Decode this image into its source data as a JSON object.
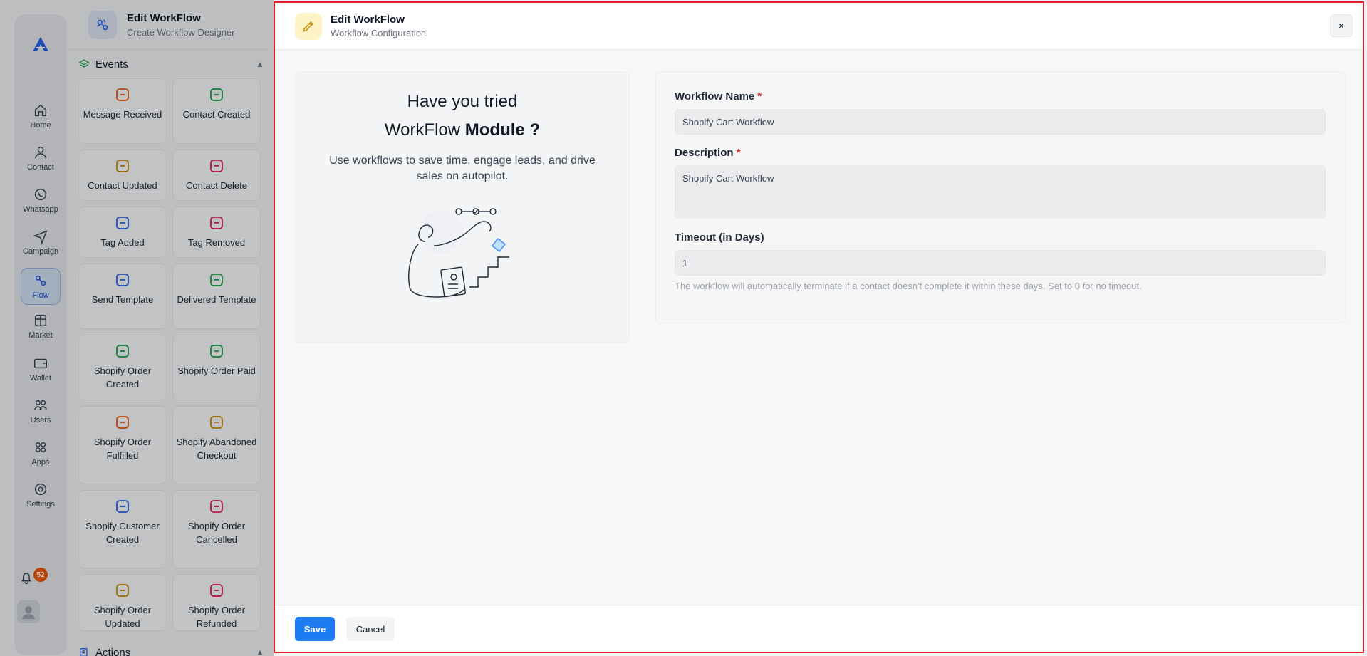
{
  "rail": {
    "items": [
      {
        "label": "Home",
        "icon": "home-icon"
      },
      {
        "label": "Contact",
        "icon": "user-icon"
      },
      {
        "label": "Whatsapp",
        "icon": "whatsapp-icon"
      },
      {
        "label": "Campaign",
        "icon": "send-icon"
      },
      {
        "label": "Flow",
        "icon": "flow-icon"
      },
      {
        "label": "Market",
        "icon": "store-icon"
      },
      {
        "label": "Wallet",
        "icon": "wallet-icon"
      },
      {
        "label": "Users",
        "icon": "users-icon"
      },
      {
        "label": "Apps",
        "icon": "apps-icon"
      },
      {
        "label": "Settings",
        "icon": "settings-icon"
      }
    ],
    "active": "Flow",
    "notification_count": "52"
  },
  "designer": {
    "title": "Edit WorkFlow",
    "subtitle": "Create Workflow Designer",
    "events_heading": "Events",
    "actions_heading": "Actions",
    "events": [
      {
        "label": "Message Received",
        "color": "#ea580c"
      },
      {
        "label": "Contact Created",
        "color": "#16a34a"
      },
      {
        "label": "Contact Updated",
        "color": "#ca8a04"
      },
      {
        "label": "Contact Delete",
        "color": "#e11d48"
      },
      {
        "label": "Tag Added",
        "color": "#2563eb"
      },
      {
        "label": "Tag Removed",
        "color": "#e11d48"
      },
      {
        "label": "Send Template",
        "color": "#2563eb"
      },
      {
        "label": "Delivered Template",
        "color": "#16a34a"
      },
      {
        "label": "Shopify Order Created",
        "color": "#16a34a"
      },
      {
        "label": "Shopify Order Paid",
        "color": "#16a34a"
      },
      {
        "label": "Shopify Order Fulfilled",
        "color": "#ea580c"
      },
      {
        "label": "Shopify Abandoned Checkout",
        "color": "#ca8a04"
      },
      {
        "label": "Shopify Customer Created",
        "color": "#2563eb"
      },
      {
        "label": "Shopify Order Cancelled",
        "color": "#e11d48"
      },
      {
        "label": "Shopify Order Updated",
        "color": "#ca8a04"
      },
      {
        "label": "Shopify Order Refunded",
        "color": "#e11d48"
      }
    ]
  },
  "modal": {
    "title": "Edit WorkFlow",
    "subtitle": "Workflow Configuration",
    "close_label": "×",
    "promo": {
      "line1": "Have you tried",
      "line2_prefix": "WorkFlow",
      "line2_bold": "Module ?",
      "description": "Use workflows to save time, engage leads, and drive sales on autopilot."
    },
    "form": {
      "name_label": "Workflow Name",
      "name_value": "Shopify Cart Workflow",
      "description_label": "Description",
      "description_value": "Shopify Cart Workflow",
      "timeout_label": "Timeout (in Days)",
      "timeout_value": "1",
      "required_mark": "*",
      "help_text": "The workflow will automatically terminate if a contact doesn't complete it within these days. Set to 0 for no timeout."
    },
    "footer": {
      "save_label": "Save",
      "cancel_label": "Cancel"
    }
  }
}
